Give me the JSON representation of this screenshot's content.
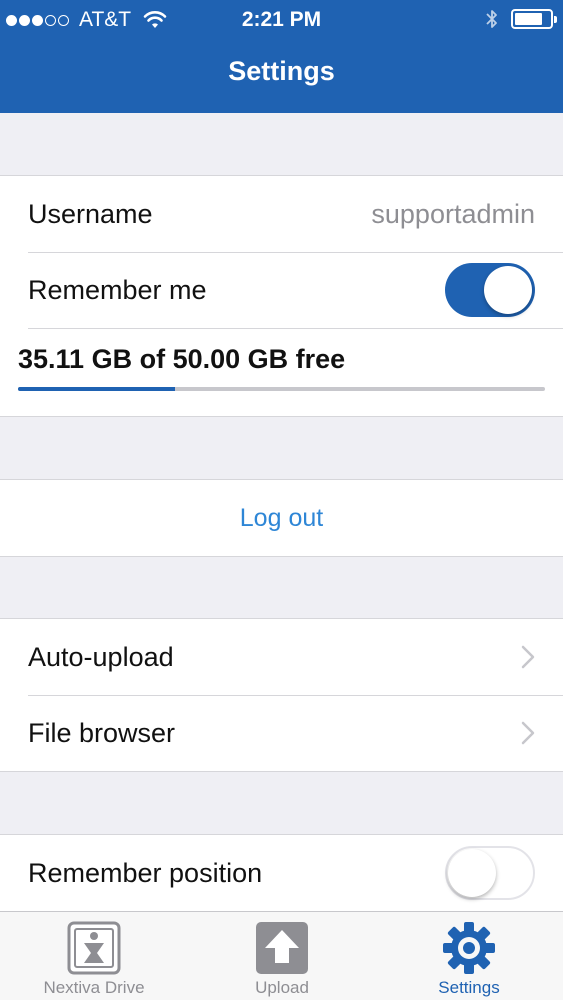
{
  "status_bar": {
    "carrier": "AT&T",
    "time": "2:21 PM",
    "signal_strength": 3,
    "signal_max": 5,
    "battery_level": 0.8
  },
  "header": {
    "title": "Settings"
  },
  "account": {
    "username_label": "Username",
    "username_value": "supportadmin",
    "remember_me_label": "Remember me",
    "remember_me_on": true,
    "storage_text": "35.11 GB of 50.00 GB free",
    "storage_used_fraction": 0.298
  },
  "actions": {
    "logout_label": "Log out"
  },
  "navigation": {
    "auto_upload_label": "Auto-upload",
    "file_browser_label": "File browser"
  },
  "preferences": {
    "remember_position_label": "Remember position",
    "remember_position_on": false
  },
  "tabbar": {
    "tabs": [
      {
        "label": "Nextiva Drive",
        "icon": "nextiva-drive-icon",
        "active": false
      },
      {
        "label": "Upload",
        "icon": "upload-icon",
        "active": false
      },
      {
        "label": "Settings",
        "icon": "gear-icon",
        "active": true
      }
    ]
  },
  "colors": {
    "accent": "#1f62b2",
    "link": "#2e86d6",
    "inactive": "#8e8e93"
  }
}
